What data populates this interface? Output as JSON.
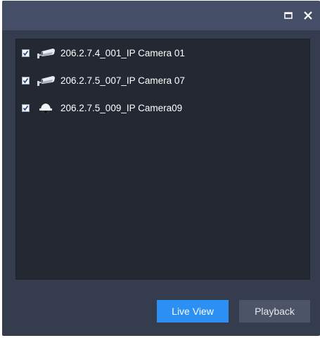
{
  "window": {
    "maximize_icon": "maximize-icon",
    "close_icon": "close-icon"
  },
  "camera_list": [
    {
      "label": "206.2.7.4_001_IP Camera 01",
      "checked": true,
      "icon": "bullet-camera-icon"
    },
    {
      "label": "206.2.7.5_007_IP Camera 07",
      "checked": true,
      "icon": "bullet-camera-icon"
    },
    {
      "label": "206.2.7.5_009_IP Camera09",
      "checked": true,
      "icon": "dome-camera-icon"
    }
  ],
  "buttons": {
    "live_view_label": "Live View",
    "playback_label": "Playback"
  },
  "colors": {
    "window_bg": "#343c4d",
    "titlebar_bg": "#444e66",
    "list_bg": "#232833",
    "primary_button": "#2b8ff4",
    "secondary_button": "#4b5567"
  }
}
